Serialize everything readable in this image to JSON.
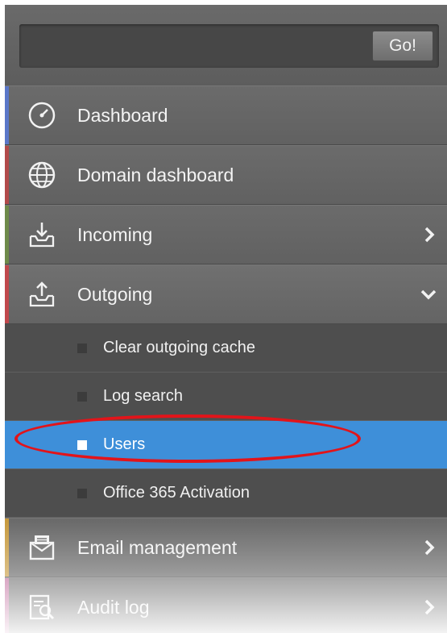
{
  "search": {
    "button_label": "Go!",
    "value": ""
  },
  "menu": {
    "dashboard": {
      "label": "Dashboard",
      "accent": "#5a77c8",
      "icon": "gauge-icon"
    },
    "domain_dashboard": {
      "label": "Domain dashboard",
      "accent": "#b14a4a",
      "icon": "globe-icon"
    },
    "incoming": {
      "label": "Incoming",
      "accent": "#6e8a4a",
      "icon": "inbox-download-icon"
    },
    "outgoing": {
      "label": "Outgoing",
      "accent": "#c0484c",
      "icon": "outbox-upload-icon",
      "expanded": true,
      "subitems": [
        {
          "label": "Clear outgoing cache",
          "active": false
        },
        {
          "label": "Log search",
          "active": false
        },
        {
          "label": "Users",
          "active": true
        },
        {
          "label": "Office 365 Activation",
          "active": false
        }
      ]
    },
    "email_management": {
      "label": "Email management",
      "accent": "#c79a3e",
      "icon": "envelope-icon"
    },
    "audit_log": {
      "label": "Audit log",
      "accent": "#c06a9c",
      "icon": "audit-log-icon"
    }
  },
  "colors": {
    "active_subitem": "#3e8fd9",
    "annotation": "#e2141a"
  }
}
